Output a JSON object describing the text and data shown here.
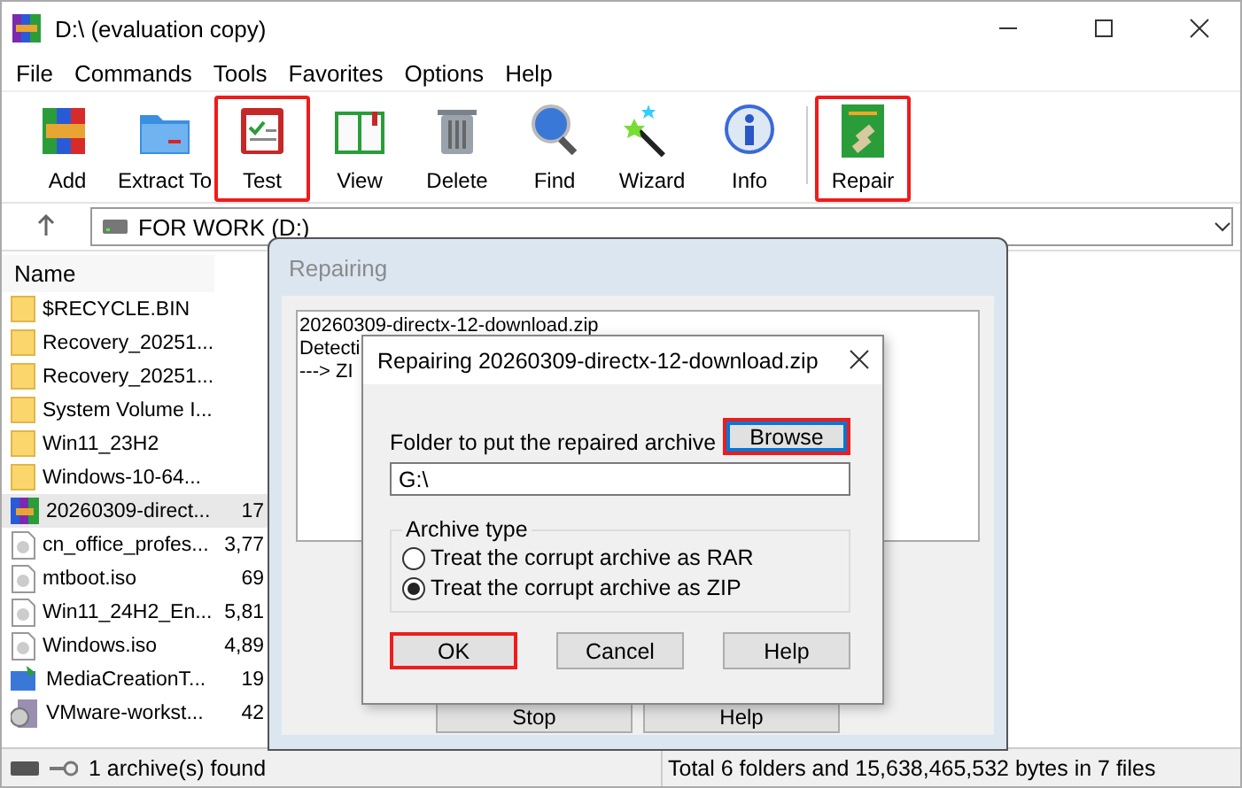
{
  "window": {
    "title": "D:\\ (evaluation copy)"
  },
  "menu": [
    "File",
    "Commands",
    "Tools",
    "Favorites",
    "Options",
    "Help"
  ],
  "toolbar": [
    {
      "label": "Add",
      "highlighted": false
    },
    {
      "label": "Extract To",
      "highlighted": false
    },
    {
      "label": "Test",
      "highlighted": true
    },
    {
      "label": "View",
      "highlighted": false
    },
    {
      "label": "Delete",
      "highlighted": false
    },
    {
      "label": "Find",
      "highlighted": false
    },
    {
      "label": "Wizard",
      "highlighted": false
    },
    {
      "label": "Info",
      "highlighted": false
    },
    {
      "label": "Repair",
      "highlighted": true
    }
  ],
  "address": {
    "value": "FOR WORK (D:)"
  },
  "file_list": {
    "columns": [
      "Name"
    ],
    "rows": [
      {
        "kind": "folder",
        "name": "$RECYCLE.BIN",
        "size": "",
        "selected": false
      },
      {
        "kind": "folder",
        "name": "Recovery_20251...",
        "size": "",
        "selected": false
      },
      {
        "kind": "folder",
        "name": "Recovery_20251...",
        "size": "",
        "selected": false
      },
      {
        "kind": "folder",
        "name": "System Volume I...",
        "size": "",
        "selected": false
      },
      {
        "kind": "folder",
        "name": "Win11_23H2",
        "size": "",
        "selected": false
      },
      {
        "kind": "folder",
        "name": "Windows-10-64...",
        "size": "",
        "selected": false
      },
      {
        "kind": "archive",
        "name": "20260309-direct...",
        "size": "17",
        "selected": true
      },
      {
        "kind": "file",
        "name": "cn_office_profes...",
        "size": "3,77",
        "selected": false
      },
      {
        "kind": "file",
        "name": "mtboot.iso",
        "size": "69",
        "selected": false
      },
      {
        "kind": "file",
        "name": "Win11_24H2_En...",
        "size": "5,81",
        "selected": false
      },
      {
        "kind": "file",
        "name": "Windows.iso",
        "size": "4,89",
        "selected": false
      },
      {
        "kind": "setup",
        "name": "MediaCreationT...",
        "size": "19",
        "selected": false
      },
      {
        "kind": "vm",
        "name": "VMware-workst...",
        "size": "42",
        "selected": false
      }
    ]
  },
  "status_bar": {
    "left": "1 archive(s) found",
    "right": "Total 6 folders and 15,638,465,532 bytes in 7 files"
  },
  "progress_dialog": {
    "title": "Repairing",
    "log": [
      "20260309-directx-12-download.zip",
      "Detecti",
      "---> ZI"
    ],
    "buttons": [
      "Stop",
      "Help"
    ]
  },
  "repair_dialog": {
    "title": "Repairing 20260309-directx-12-download.zip",
    "folder_label": "Folder to put the repaired archive",
    "browse": {
      "label": "Browse",
      "highlighted": true
    },
    "folder": {
      "value": "G:\\"
    },
    "archive_type": {
      "title": "Archive type",
      "options": [
        {
          "label": "Treat the corrupt archive as RAR",
          "selected": false
        },
        {
          "label": "Treat the corrupt archive as ZIP",
          "selected": true
        }
      ]
    },
    "buttons": [
      {
        "label": "OK",
        "highlighted": true
      },
      {
        "label": "Cancel",
        "highlighted": false
      },
      {
        "label": "Help",
        "highlighted": false
      }
    ]
  }
}
